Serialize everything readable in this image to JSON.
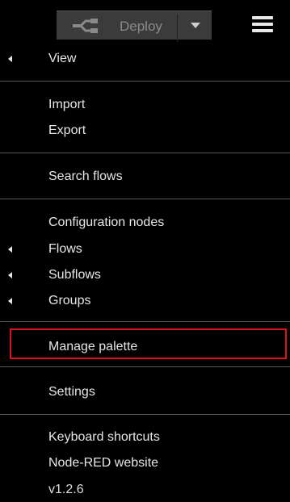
{
  "header": {
    "deploy_label": "Deploy",
    "menu_icon": "hamburger-menu-icon"
  },
  "menu": {
    "view": "View",
    "import": "Import",
    "export": "Export",
    "search_flows": "Search flows",
    "configuration_nodes": "Configuration nodes",
    "flows": "Flows",
    "subflows": "Subflows",
    "groups": "Groups",
    "manage_palette": "Manage palette",
    "settings": "Settings",
    "keyboard_shortcuts": "Keyboard shortcuts",
    "node_red_website": "Node-RED website",
    "version": "v1.2.6"
  },
  "highlight_color": "#e0101c"
}
